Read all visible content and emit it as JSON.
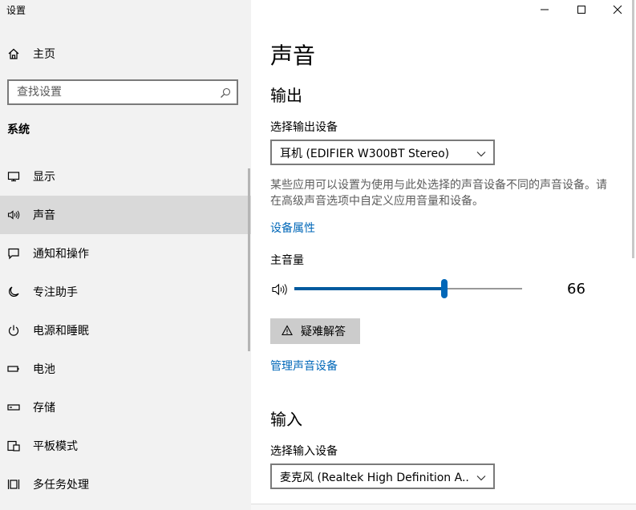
{
  "window": {
    "title": "设置"
  },
  "sidebar": {
    "home_label": "主页",
    "search_placeholder": "查找设置",
    "group_heading": "系统",
    "items": [
      {
        "label": "显示",
        "icon": "display-icon"
      },
      {
        "label": "声音",
        "icon": "speaker-icon",
        "active": true
      },
      {
        "label": "通知和操作",
        "icon": "notification-icon"
      },
      {
        "label": "专注助手",
        "icon": "moon-icon"
      },
      {
        "label": "电源和睡眠",
        "icon": "power-icon"
      },
      {
        "label": "电池",
        "icon": "battery-icon"
      },
      {
        "label": "存储",
        "icon": "storage-icon"
      },
      {
        "label": "平板模式",
        "icon": "tablet-mode-icon"
      },
      {
        "label": "多任务处理",
        "icon": "multitasking-icon"
      }
    ]
  },
  "main": {
    "page_title": "声音",
    "output": {
      "section_title": "输出",
      "device_label": "选择输出设备",
      "device_value": "耳机 (EDIFIER W300BT Stereo)",
      "description": "某些应用可以设置为使用与此处选择的声音设备不同的声音设备。请在高级声音选项中自定义应用音量和设备。",
      "properties_link": "设备属性",
      "master_volume_label": "主音量",
      "volume": 66,
      "volume_display": "66",
      "troubleshoot_label": "疑难解答",
      "manage_devices_link": "管理声音设备"
    },
    "input": {
      "section_title": "输入",
      "device_label": "选择输入设备",
      "device_value": "麦克风 (Realtek High Definition A..."
    }
  },
  "colors": {
    "accent": "#0067b8",
    "sidebar_bg": "#f2f2f2",
    "active_item_bg": "#d9d9d9"
  }
}
